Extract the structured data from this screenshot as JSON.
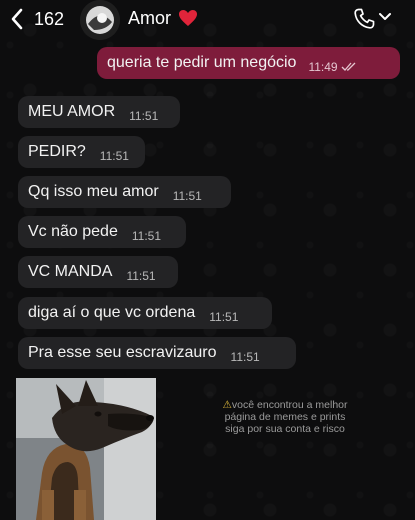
{
  "header": {
    "unread_count": "162",
    "contact_name": "Amor",
    "icons": [
      "back-chevron-icon",
      "avatar",
      "red-heart-icon",
      "phone-icon",
      "chevron-down-icon"
    ],
    "heart_color": "#e0243a"
  },
  "messages": [
    {
      "direction": "outgoing",
      "text": "queria te pedir um negócio",
      "time": "11:49",
      "status": "read"
    },
    {
      "direction": "incoming",
      "text": "MEU AMOR",
      "time": "11:51"
    },
    {
      "direction": "incoming",
      "text": "PEDIR?",
      "time": "11:51"
    },
    {
      "direction": "incoming",
      "text": "Qq isso meu amor",
      "time": "11:51"
    },
    {
      "direction": "incoming",
      "text": "Vc não pede",
      "time": "11:51"
    },
    {
      "direction": "incoming",
      "text": "VC MANDA",
      "time": "11:51"
    },
    {
      "direction": "incoming",
      "text": "diga aí o que vc ordena",
      "time": "11:51"
    },
    {
      "direction": "incoming",
      "text": "Pra esse seu escravizauro",
      "time": "11:51"
    }
  ],
  "watermark": {
    "line1": "você encontrou a melhor",
    "line2": "página de memes e prints",
    "line3": "siga por sua conta e risco"
  },
  "colors": {
    "outgoing_bubble": "#7e1c3b",
    "incoming_bubble": "#232325",
    "background": "#0d0d0e"
  }
}
